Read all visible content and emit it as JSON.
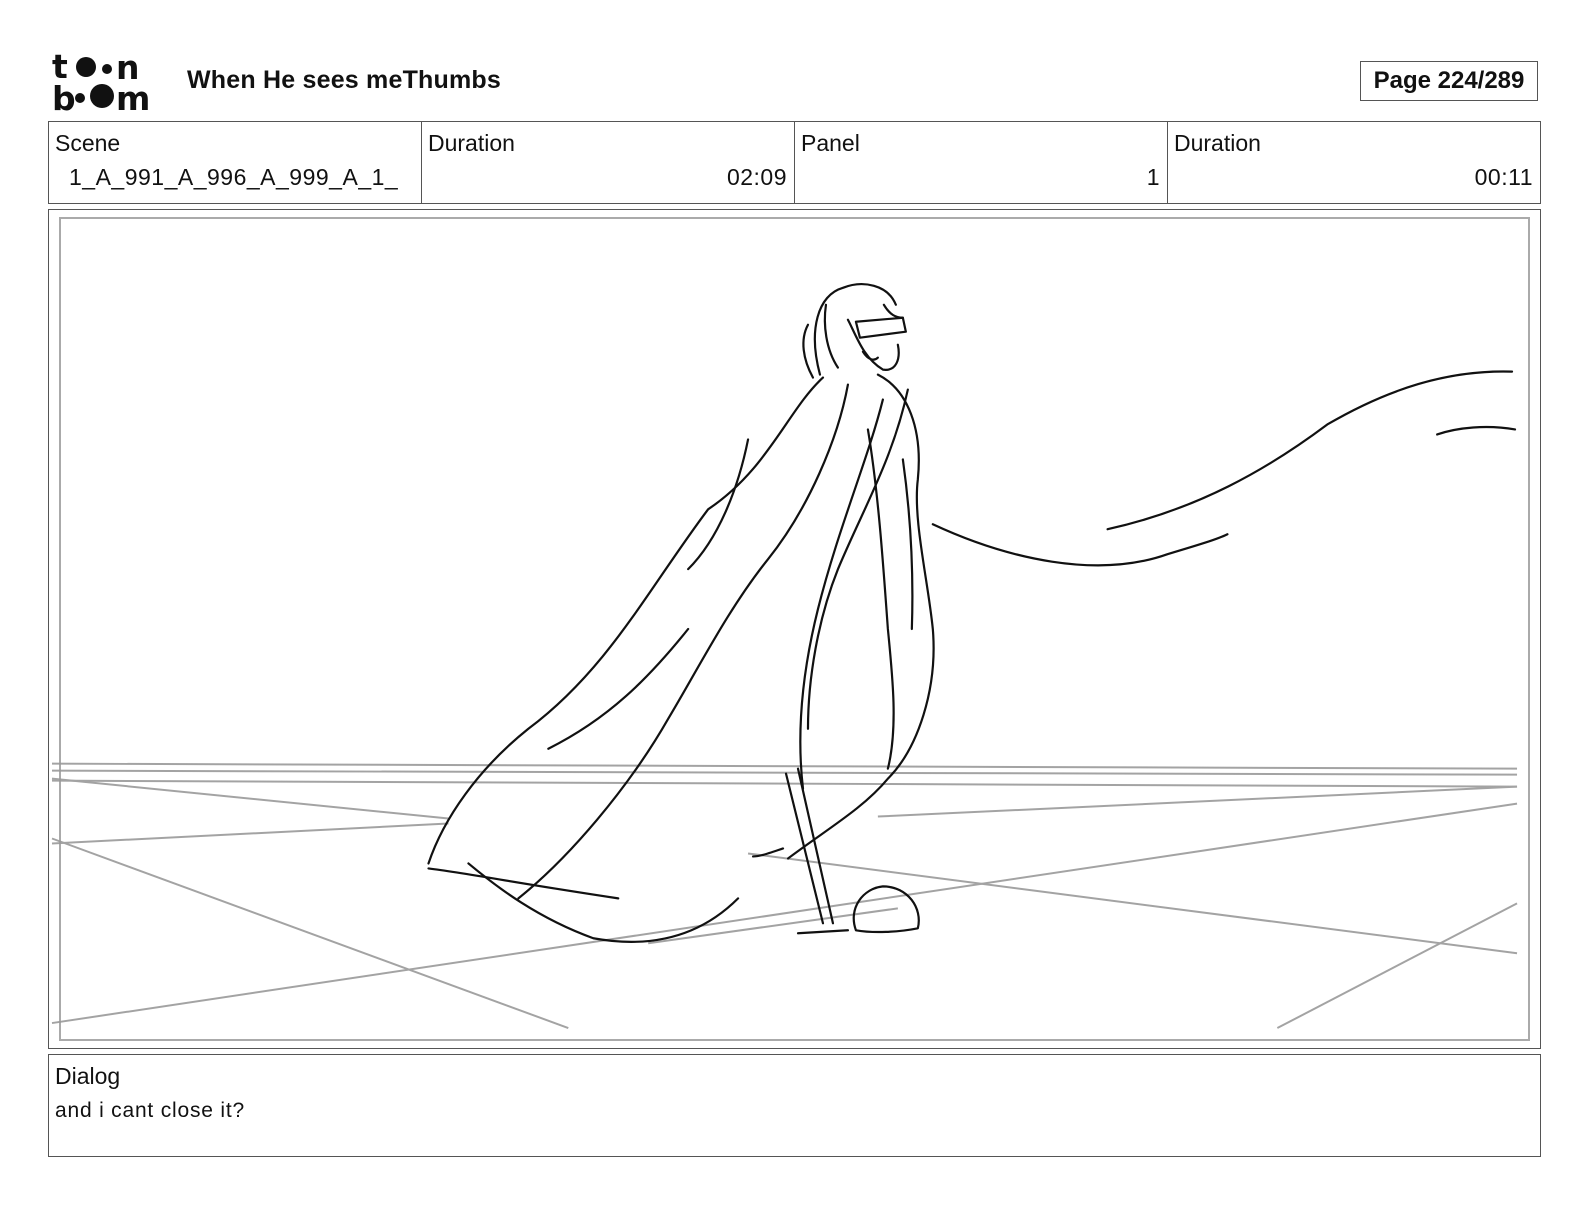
{
  "header": {
    "logo": {
      "icon": "toonboom-logo",
      "line1": "t●●n",
      "line2": "b●●m"
    },
    "title": "When He sees meThumbs",
    "page": "Page 224/289"
  },
  "info": {
    "scene_label": "Scene",
    "scene_value": "1_A_991_A_996_A_999_A_1_",
    "scene_duration_label": "Duration",
    "scene_duration_value": "02:09",
    "panel_label": "Panel",
    "panel_value": "1",
    "panel_duration_label": "Duration",
    "panel_duration_value": "00:11"
  },
  "panel": {
    "image": "pencil-sketch-cloaked-figure"
  },
  "dialog": {
    "label": "Dialog",
    "text": "and i cant close it?"
  },
  "colors": {
    "border": "#555555",
    "inner_frame": "#aaaaaa",
    "sketch_line": "#111111",
    "grid_line": "#9a9a9a"
  }
}
